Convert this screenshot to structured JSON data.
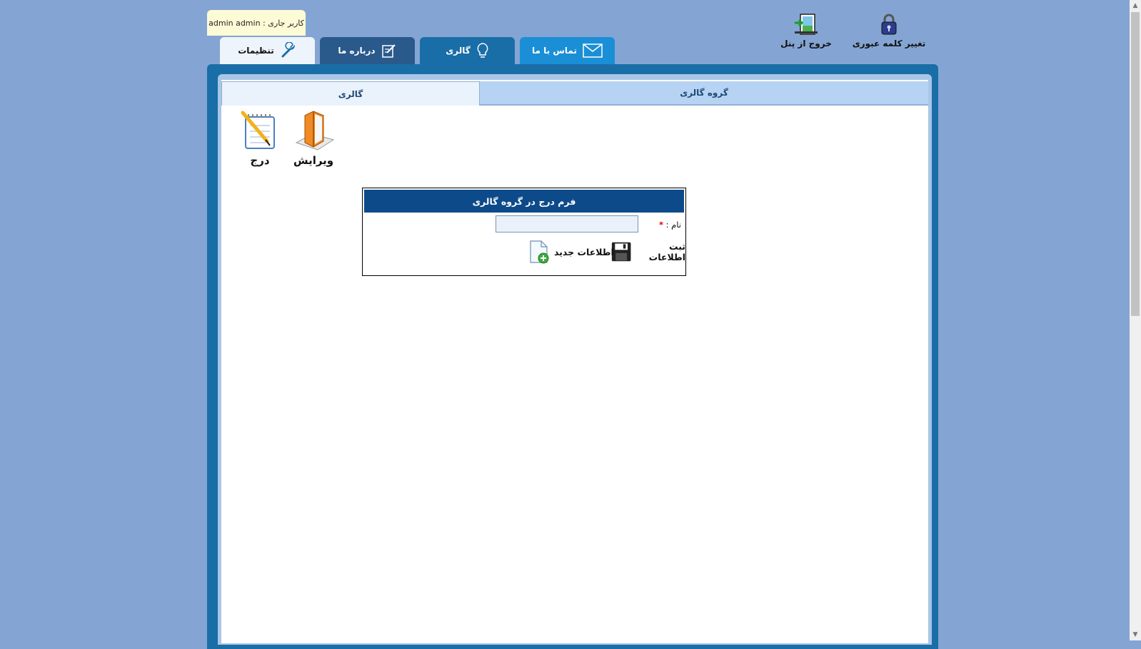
{
  "user": {
    "label": "admin admin : کاربر جاری"
  },
  "top_actions": {
    "change_password": "تغییر کلمه عبوری",
    "logout": "خروج از پنل"
  },
  "tabs": [
    {
      "label": "تماس با ما",
      "color": "#1a8fd6"
    },
    {
      "label": "گالری",
      "color": "#1a6ea7"
    },
    {
      "label": "درباره ما",
      "color": "#2a5a8c"
    },
    {
      "label": "تنظیمات",
      "color": "#eef4fb"
    }
  ],
  "subtabs": {
    "group": "گروه گالری",
    "gallery": "گالری"
  },
  "tools": {
    "edit": "ویرایش",
    "insert": "درج"
  },
  "form": {
    "title": "فرم درج در گروه گالری",
    "name_label": "نام :",
    "required_mark": "*",
    "name_value": "",
    "save": "ثبت اطلاعات",
    "new": "اطلاعات جدید"
  },
  "colors": {
    "background": "#84a5d3",
    "frame": "#1a6ea7",
    "form_header": "#0d4a8a"
  }
}
